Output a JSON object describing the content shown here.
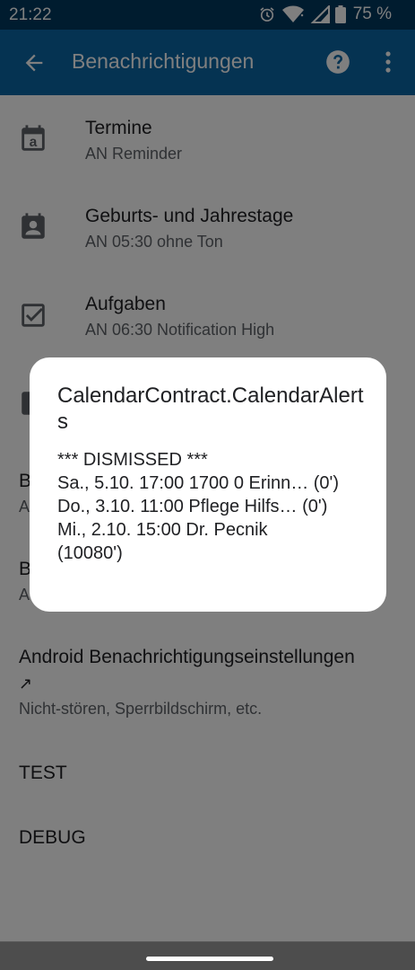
{
  "status_bar": {
    "time": "21:22",
    "battery_percent": "75 %",
    "icons": [
      "alarm-icon",
      "wifi-icon",
      "signal-icon",
      "battery-icon"
    ]
  },
  "app_bar": {
    "title": "Benachrichtigungen",
    "icons": [
      "back-arrow-icon",
      "help-icon",
      "overflow-menu-icon"
    ]
  },
  "list": {
    "items": [
      {
        "title": "Termine",
        "subtitle": "AN Reminder",
        "icon": "calendar-a-icon"
      },
      {
        "title": "Geburts- und Jahrestage",
        "subtitle": "AN 05:30 ohne Ton",
        "icon": "contact-calendar-icon"
      },
      {
        "title": "Aufgaben",
        "subtitle": "AN 06:30 Notification High",
        "icon": "checkbox-icon"
      }
    ],
    "partial_items": [
      {
        "title": "B",
        "subtitle": "A"
      },
      {
        "title": "B",
        "subtitle": "A"
      }
    ],
    "android_settings": {
      "title": "Android Benachrichtigungseinstellungen",
      "arrow": "↗",
      "subtitle": "Nicht-stören, Sperrbildschirm, etc."
    },
    "test_label": "TEST",
    "debug_label": "DEBUG"
  },
  "dialog": {
    "title": "CalendarContract.CalendarAlerts",
    "lines": [
      "*** DISMISSED ***",
      "Sa., 5.10. 17:00 1700 0 Erinn… (0')",
      "Do., 3.10. 11:00 Pflege Hilfs… (0')",
      "Mi., 2.10. 15:00 Dr. Pecnik (10080')"
    ]
  },
  "colors": {
    "status_bar": "#00385f",
    "app_bar": "#0b66a4",
    "scrim": "rgba(0,0,0,0.5)",
    "dialog_bg": "#ffffff"
  }
}
